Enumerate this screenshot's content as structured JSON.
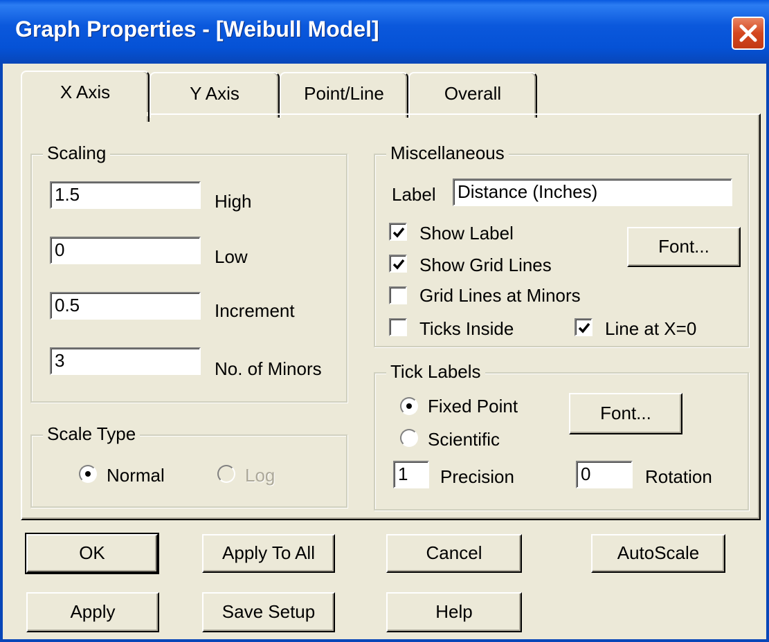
{
  "window": {
    "title": "Graph Properties - [Weibull Model]"
  },
  "tabs": [
    {
      "label": "X Axis",
      "active": true
    },
    {
      "label": "Y Axis",
      "active": false
    },
    {
      "label": "Point/Line",
      "active": false
    },
    {
      "label": "Overall",
      "active": false
    }
  ],
  "scaling": {
    "title": "Scaling",
    "high": {
      "value": "1.5",
      "label": "High"
    },
    "low": {
      "value": "0",
      "label": "Low"
    },
    "increment": {
      "value": "0.5",
      "label": "Increment"
    },
    "minors": {
      "value": "3",
      "label": "No. of Minors"
    }
  },
  "scale_type": {
    "title": "Scale Type",
    "options": [
      {
        "label": "Normal",
        "selected": true,
        "enabled": true
      },
      {
        "label": "Log",
        "selected": false,
        "enabled": false
      }
    ]
  },
  "misc": {
    "title": "Miscellaneous",
    "label_caption": "Label",
    "label_value": "Distance (Inches)",
    "font_button": "Font...",
    "show_label": {
      "label": "Show Label",
      "checked": true
    },
    "show_grid": {
      "label": "Show Grid Lines",
      "checked": true
    },
    "grid_minors": {
      "label": "Grid Lines at Minors",
      "checked": false
    },
    "ticks_inside": {
      "label": "Ticks Inside",
      "checked": false
    },
    "line_zero": {
      "label": "Line at X=0",
      "checked": true
    }
  },
  "tick_labels": {
    "title": "Tick Labels",
    "fixed": {
      "label": "Fixed Point",
      "selected": true
    },
    "scientific": {
      "label": "Scientific",
      "selected": false
    },
    "font_button": "Font...",
    "precision": {
      "value": "1",
      "label": "Precision"
    },
    "rotation": {
      "value": "0",
      "label": "Rotation"
    }
  },
  "buttons": {
    "ok": "OK",
    "apply_to_all": "Apply To All",
    "cancel": "Cancel",
    "autoscale": "AutoScale",
    "apply": "Apply",
    "save_setup": "Save Setup",
    "help": "Help"
  }
}
